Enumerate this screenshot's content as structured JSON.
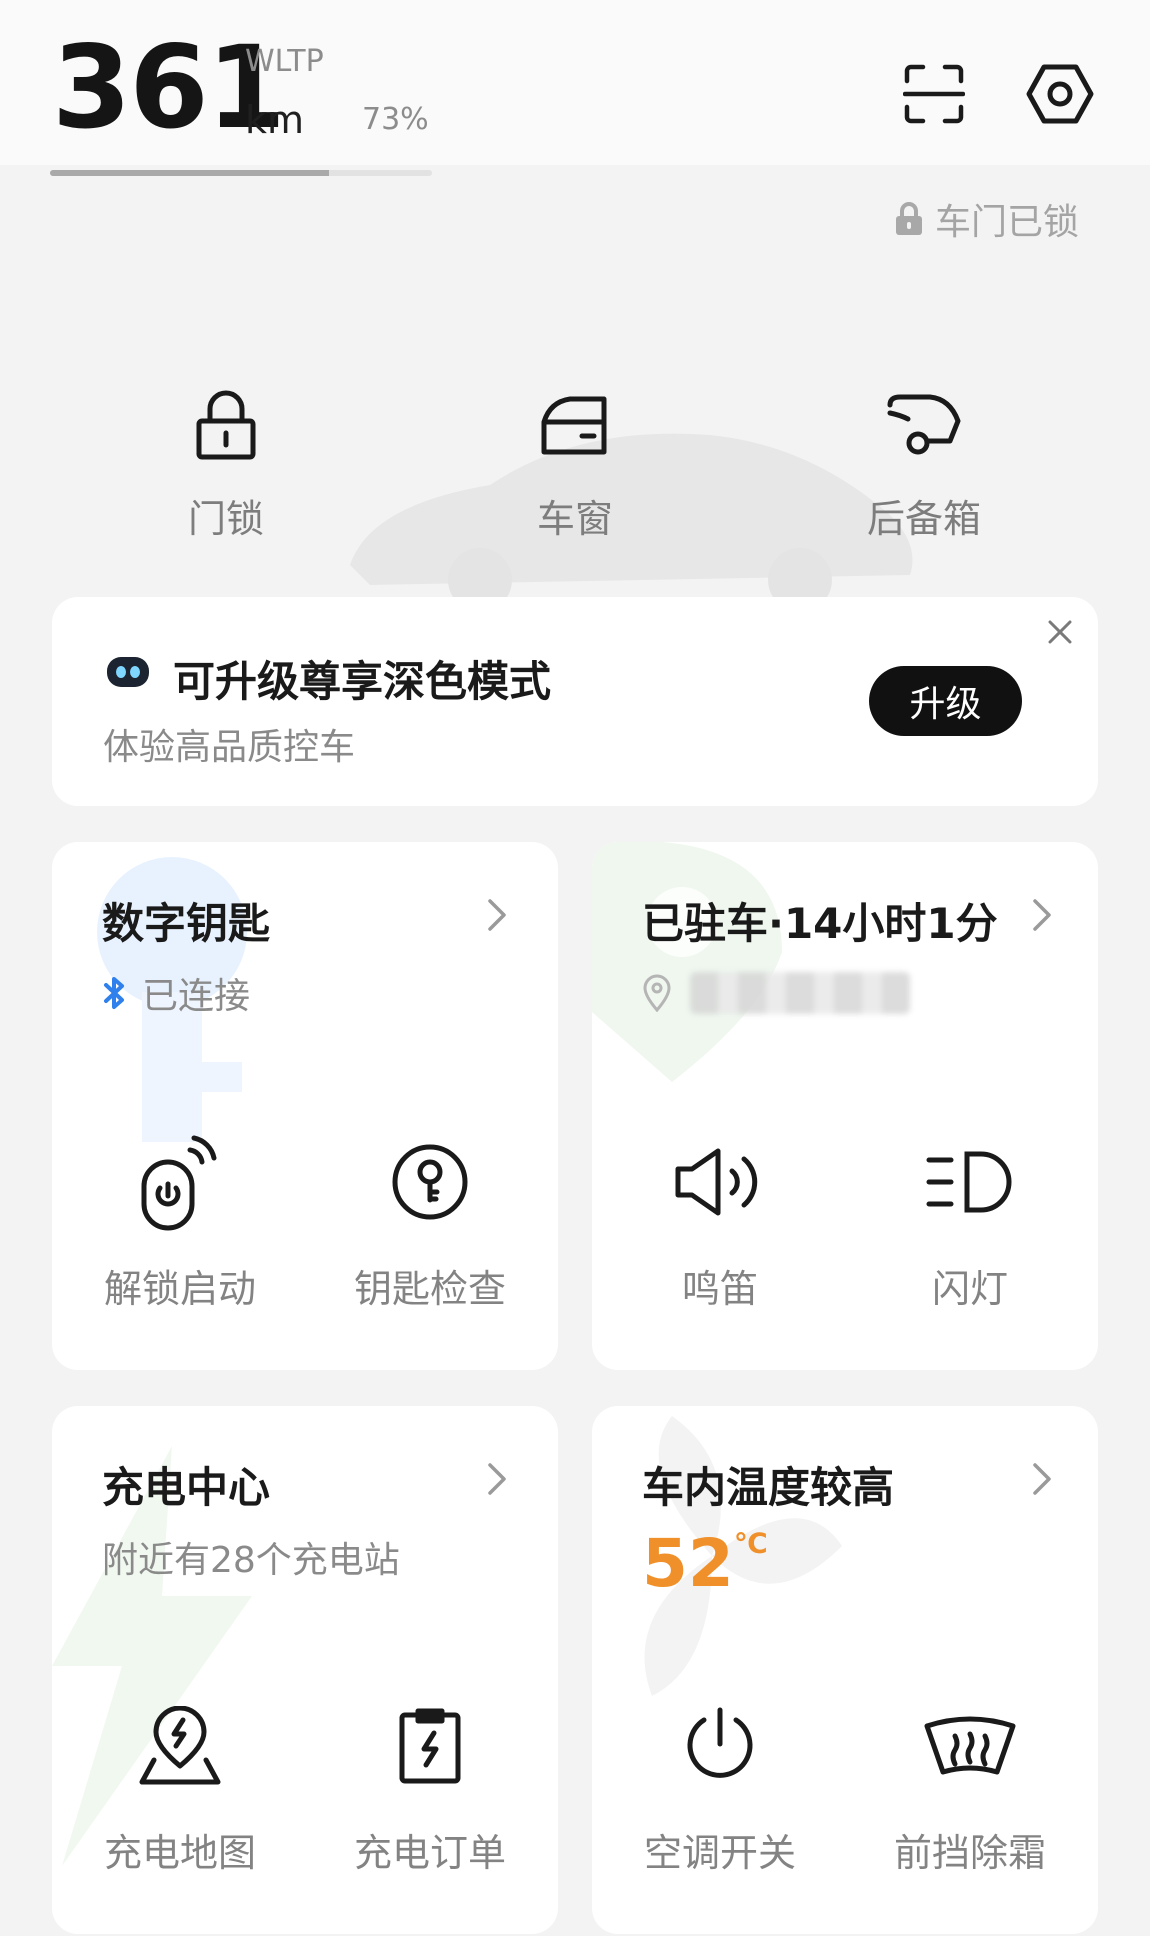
{
  "header": {
    "range_value": "361",
    "range_standard": "WLTP",
    "range_unit": "km",
    "battery_percent": "73%",
    "battery_level": 0.73,
    "icons": [
      "scan-icon",
      "settings-hex-icon"
    ]
  },
  "door_status": {
    "icon": "lock-icon",
    "label": "车门已锁"
  },
  "quick_controls": [
    {
      "label": "门锁",
      "icon": "padlock-icon"
    },
    {
      "label": "车窗",
      "icon": "car-window-icon"
    },
    {
      "label": "后备箱",
      "icon": "trunk-icon"
    }
  ],
  "promo": {
    "title": "可升级尊享深色模式",
    "subtitle": "体验高品质控车",
    "button_label": "升级",
    "close_icon": "close-icon"
  },
  "cards": {
    "digital_key": {
      "title": "数字钥匙",
      "status_icon": "bluetooth-icon",
      "status": "已连接",
      "actions": [
        {
          "label": "解锁启动",
          "icon": "remote-start-icon"
        },
        {
          "label": "钥匙检查",
          "icon": "key-check-icon"
        }
      ]
    },
    "parking": {
      "title": "已驻车·14小时1分",
      "location_icon": "location-pin-icon",
      "actions": [
        {
          "label": "鸣笛",
          "icon": "horn-icon"
        },
        {
          "label": "闪灯",
          "icon": "headlight-icon"
        }
      ]
    },
    "charging": {
      "title": "充电中心",
      "subtitle": "附近有28个充电站",
      "actions": [
        {
          "label": "充电地图",
          "icon": "charge-map-icon"
        },
        {
          "label": "充电订单",
          "icon": "charge-order-icon"
        }
      ]
    },
    "climate": {
      "title": "车内温度较高",
      "temperature": "52",
      "temperature_unit": "℃",
      "actions": [
        {
          "label": "空调开关",
          "icon": "power-icon"
        },
        {
          "label": "前挡除霜",
          "icon": "defrost-icon"
        }
      ]
    }
  },
  "colors": {
    "accent_temperature": "#f0902a",
    "bluetooth": "#2f80ed",
    "button_dark": "#111111"
  }
}
